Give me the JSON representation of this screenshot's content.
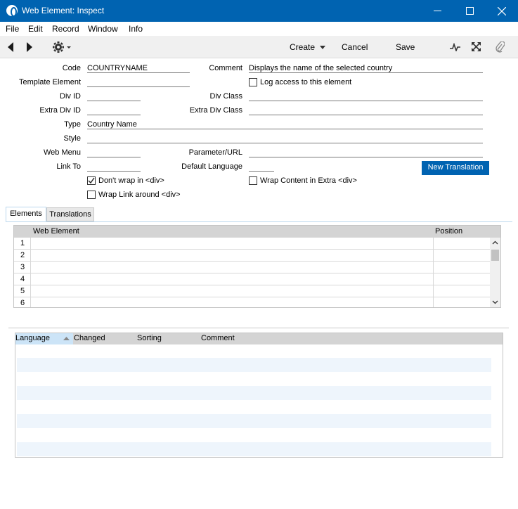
{
  "window": {
    "title": "Web Element: Inspect",
    "icon": "app-icon",
    "controls": [
      "minimize-icon",
      "maximize-icon",
      "close-icon"
    ]
  },
  "menu": {
    "file": "File",
    "edit": "Edit",
    "record": "Record",
    "window": "Window",
    "info": "Info"
  },
  "toolbar": {
    "create": "Create",
    "cancel": "Cancel",
    "save": "Save"
  },
  "form": {
    "code_label": "Code",
    "code_value": "COUNTRYNAME",
    "comment_label": "Comment",
    "comment_value": "Displays the name of the selected country",
    "template_label": "Template Element",
    "template_value": "",
    "log_access_label": "Log access to this element",
    "log_access_checked": false,
    "div_id_label": "Div ID",
    "div_id_value": "",
    "div_class_label": "Div Class",
    "div_class_value": "",
    "extra_div_id_label": "Extra Div ID",
    "extra_div_id_value": "",
    "extra_div_class_label": "Extra Div Class",
    "extra_div_class_value": "",
    "type_label": "Type",
    "type_value": "Country Name",
    "style_label": "Style",
    "style_value": "",
    "web_menu_label": "Web Menu",
    "web_menu_value": "",
    "param_label": "Parameter/URL",
    "param_value": "",
    "link_to_label": "Link To",
    "link_to_value": "",
    "default_lang_label": "Default Language",
    "default_lang_value": "",
    "new_translation": "New Translation",
    "dont_wrap_label": "Don't wrap in <div>",
    "dont_wrap_checked": true,
    "wrap_extra_label": "Wrap Content in Extra <div>",
    "wrap_extra_checked": false,
    "wrap_link_label": "Wrap Link around <div>",
    "wrap_link_checked": false
  },
  "tabs": {
    "elements": "Elements",
    "translations": "Translations",
    "active": "Elements"
  },
  "elements_matrix": {
    "col_web_element": "Web Element",
    "col_position": "Position",
    "rows": [
      "1",
      "2",
      "3",
      "4",
      "5",
      "6"
    ]
  },
  "translations_list": {
    "col_language": "Language",
    "col_changed": "Changed",
    "col_sorting": "Sorting",
    "col_comment": "Comment"
  }
}
